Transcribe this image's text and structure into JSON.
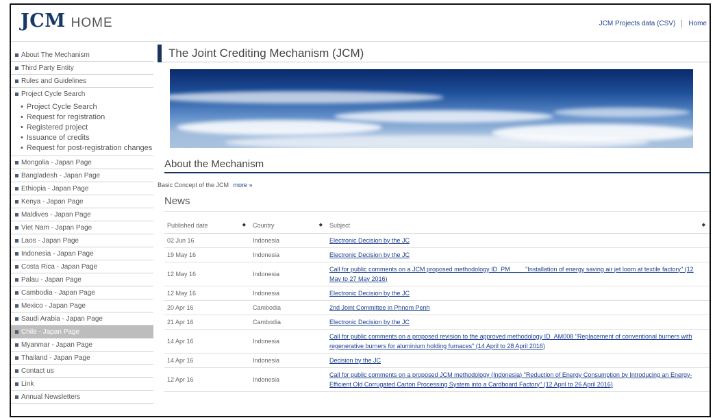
{
  "header": {
    "logo": "JCM",
    "home": "HOME",
    "links": [
      "JCM Projects data (CSV)",
      "Home"
    ]
  },
  "sidebar": {
    "items": [
      {
        "label": "About The Mechanism"
      },
      {
        "label": "Third Party Entity"
      },
      {
        "label": "Rules and Guidelines"
      },
      {
        "label": "Project Cycle Search"
      }
    ],
    "subitems": [
      "Project Cycle Search",
      "Request for registration",
      "Registered project",
      "Issuance of credits",
      "Request for post-registration changes"
    ],
    "countries": [
      "Mongolia - Japan Page",
      "Bangladesh - Japan Page",
      "Ethiopia - Japan Page",
      "Kenya - Japan Page",
      "Maldives - Japan Page",
      "Viet Nam - Japan Page",
      "Laos - Japan Page",
      "Indonesia - Japan Page",
      "Costa Rica - Japan Page",
      "Palau - Japan Page",
      "Cambodia - Japan Page",
      "Mexico - Japan Page",
      "Saudi Arabia - Japan Page",
      "Chile - Japan Page",
      "Myanmar - Japan Page",
      "Thailand - Japan Page",
      "Contact us",
      "Link",
      "Annual Newsletters"
    ],
    "active_index": 13
  },
  "main": {
    "title": "The Joint Crediting Mechanism (JCM)",
    "about_heading": "About the Mechanism",
    "basic_text": "Basic Concept of the JCM",
    "more_link": "more »",
    "news_heading": "News",
    "table": {
      "headers": [
        "Published date",
        "Country",
        "Subject"
      ],
      "rows": [
        {
          "date": "02 Jun 16",
          "country": "Indonesia",
          "subject": "Electronic Decision by the JC"
        },
        {
          "date": "19 May 16",
          "country": "Indonesia",
          "subject": "Electronic Decision by the JC"
        },
        {
          "date": "12 May 16",
          "country": "Indonesia",
          "subject": "Call for public comments on a JCM proposed methodology ID_PM____ \"Installation of energy saving air jet loom at textile factory\" (12 May to 27 May 2016)"
        },
        {
          "date": "12 May 16",
          "country": "Indonesia",
          "subject": "Electronic Decision by the JC"
        },
        {
          "date": "20 Apr 16",
          "country": "Cambodia",
          "subject": "2nd Joint Committee in Phnom Penh"
        },
        {
          "date": "21 Apr 16",
          "country": "Cambodia",
          "subject": "Electronic Decision by the JC"
        },
        {
          "date": "14 Apr 16",
          "country": "Indonesia",
          "subject": "Call for public comments on a proposed revision to the approved methodology ID_AM008 \"Replacement of conventional burners with regenerative burners for aluminium holding furnaces\" (14 April to 28 April 2016)"
        },
        {
          "date": "14 Apr 16",
          "country": "Indonesia",
          "subject": "Decision by the JC"
        },
        {
          "date": "12 Apr 16",
          "country": "Indonesia",
          "subject": "Call for public comments on a proposed JCM methodology (Indonesia) \"Reduction of Energy Consumption by Introducing an Energy-Efficient Old Corrugated Carton Processing System into a Cardboard Factory\" (12 April to 26 April 2016)"
        }
      ]
    }
  }
}
